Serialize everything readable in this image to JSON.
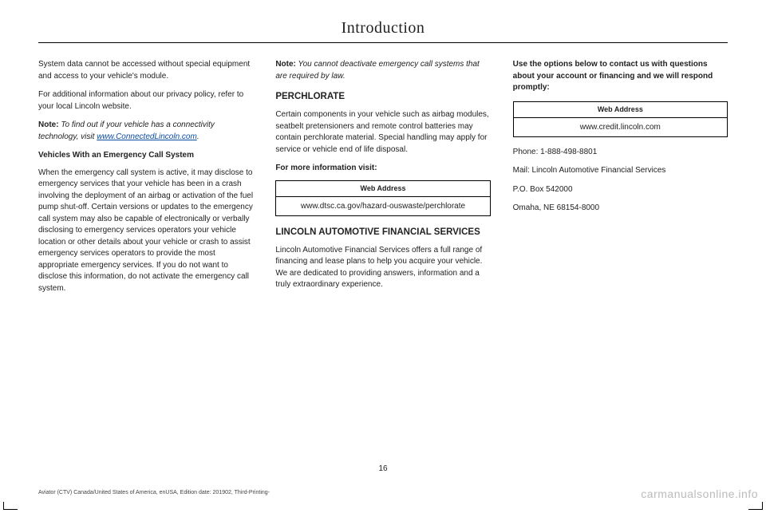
{
  "page_title": "Introduction",
  "page_number": "16",
  "footnote": "Aviator (CTV) Canada/United States of America, enUSA, Edition date: 201902, Third-Printing-",
  "watermark": "carmanualsonline.info",
  "col1": {
    "p1": "System data cannot be accessed without special equipment and access to your vehicle's module.",
    "p2": "For additional information about our privacy policy, refer to your local Lincoln website.",
    "note_label": "Note:",
    "note_text": " To find out if your vehicle has a connectivity technology, visit ",
    "note_link": "www.ConnectedLincoln.com",
    "note_period": ".",
    "sub1": "Vehicles With an Emergency Call System",
    "p3": "When the emergency call system is active, it may disclose to emergency services that your vehicle has been in a crash involving the deployment of an airbag or activation of the fuel pump shut-off. Certain versions or updates to the emergency call system may also be capable of electronically or verbally disclosing to emergency services operators your vehicle location or other details about your vehicle or crash to assist emergency services operators to provide the most appropriate emergency services. If you do not want to disclose this information, do not activate the emergency call system."
  },
  "col2": {
    "note_label": "Note:",
    "note_text": " You cannot deactivate emergency call systems that are required by law.",
    "sec1": "PERCHLORATE",
    "p1": "Certain components in your vehicle such as airbag modules, seatbelt pretensioners and remote control batteries may contain perchlorate material.  Special handling may apply for service or vehicle end of life disposal.",
    "info_label": "For more information visit:",
    "web_header": "Web Address",
    "web_value": "www.dtsc.ca.gov/hazard-ouswaste/perchlorate",
    "sec2": "LINCOLN AUTOMOTIVE FINANCIAL SERVICES",
    "p2": "Lincoln Automotive Financial Services offers a full range of financing and lease plans to help you acquire your vehicle.  We are dedicated to providing answers, information and a truly extraordinary experience."
  },
  "col3": {
    "intro": "Use the options below to contact us with questions about your account or financing and we will respond promptly:",
    "web_header": "Web Address",
    "web_value": "www.credit.lincoln.com",
    "phone": "Phone: 1-888-498-8801",
    "mail1": "Mail: Lincoln Automotive Financial Services",
    "mail2": "P.O. Box 542000",
    "mail3": "Omaha, NE 68154-8000"
  }
}
